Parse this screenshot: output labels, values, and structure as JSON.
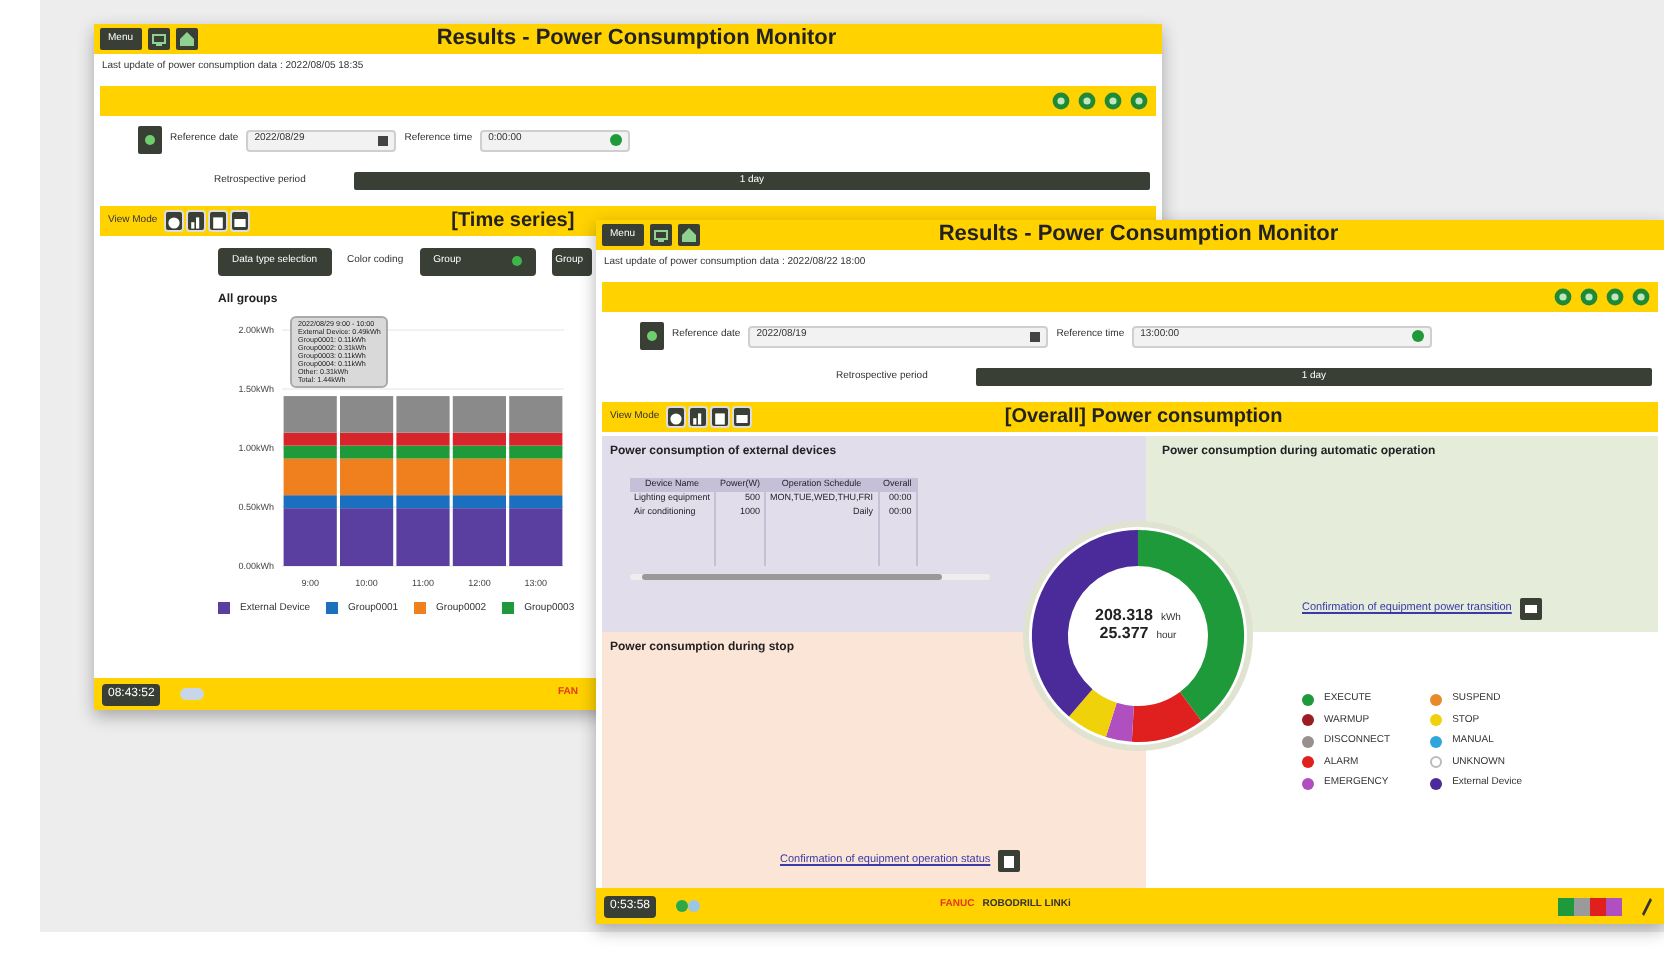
{
  "back_window": {
    "title": "Results - Power Consumption Monitor",
    "menu_button": "Menu",
    "last_update": "Last update of power consumption data : 2022/08/05 18:35",
    "reference_date_label": "Reference date",
    "reference_date": "2022/08/29",
    "reference_time_label": "Reference time",
    "reference_time": "0:00:00",
    "retrospective_label": "Retrospective period",
    "retrospective_value": "1 day",
    "view_mode_label": "View Mode",
    "view_title": "[Time series]",
    "data_type_button": "Data type selection",
    "color_coding_label": "Color coding",
    "color_coding_value": "Group",
    "group_select_button": "Group",
    "chart_title": "All groups",
    "tooltip": [
      "2022/08/29 9:00 - 10:00",
      "External Device: 0.49kWh",
      "Group0001: 0.11kWh",
      "Group0002: 0.31kWh",
      "Group0003: 0.11kWh",
      "Group0004: 0.11kWh",
      "Other: 0.31kWh",
      "Total: 1.44kWh"
    ],
    "chart_data": {
      "type": "bar",
      "stacked": true,
      "grid": true,
      "categories": [
        "9:00",
        "10:00",
        "11:00",
        "12:00",
        "13:00"
      ],
      "ylim": [
        0,
        2
      ],
      "yticks": [
        {
          "value": 0,
          "label": "0.00kWh"
        },
        {
          "value": 0.5,
          "label": "0.50kWh"
        },
        {
          "value": 1,
          "label": "1.00kWh"
        },
        {
          "value": 1.5,
          "label": "1.50kWh"
        },
        {
          "value": 2,
          "label": "2.00kWh"
        }
      ],
      "series": [
        {
          "name": "External Device",
          "color": "#5b3fa0",
          "values": [
            0.49,
            0.49,
            0.49,
            0.49,
            0.49
          ]
        },
        {
          "name": "Group0001",
          "color": "#1a6fbf",
          "values": [
            0.11,
            0.11,
            0.11,
            0.11,
            0.11
          ]
        },
        {
          "name": "Group0002",
          "color": "#f07f1e",
          "values": [
            0.31,
            0.31,
            0.31,
            0.31,
            0.31
          ]
        },
        {
          "name": "Group0003",
          "color": "#1f9a3a",
          "values": [
            0.11,
            0.11,
            0.11,
            0.11,
            0.11
          ]
        },
        {
          "color": "#d7262b",
          "values": [
            0.11,
            0.11,
            0.11,
            0.11,
            0.11
          ]
        },
        {
          "color": "#8a8a8a",
          "values": [
            0.31,
            0.31,
            0.31,
            0.31,
            0.31
          ]
        }
      ]
    },
    "clock": "08:43:52",
    "footer_brand": "FAN"
  },
  "front_window": {
    "title": "Results - Power Consumption Monitor",
    "menu_button": "Menu",
    "last_update": "Last update of power consumption data : 2022/08/22 18:00",
    "reference_date_label": "Reference date",
    "reference_date": "2022/08/19",
    "reference_time_label": "Reference time",
    "reference_time": "13:00:00",
    "retrospective_label": "Retrospective period",
    "retrospective_value": "1 day",
    "view_mode_label": "View Mode",
    "view_title": "[Overall] Power consumption",
    "external_panel": {
      "title": "Power consumption of external devices",
      "columns": [
        "Device Name",
        "Power(W)",
        "Operation Schedule",
        "Overall"
      ],
      "rows": [
        [
          "Lighting equipment",
          "500",
          "MON,TUE,WED,THU,FRI",
          "00:00"
        ],
        [
          "Air conditioning",
          "1000",
          "Daily",
          "00:00"
        ]
      ]
    },
    "auto_panel": {
      "title": "Power consumption during automatic operation",
      "link": "Confirmation of equipment power transition"
    },
    "stop_panel": {
      "title": "Power consumption during stop",
      "link": "Confirmation of equipment operation status"
    },
    "donut": {
      "energy": "208.318",
      "energy_unit": "kWh",
      "time": "25.377",
      "time_unit": "hour"
    },
    "legend": [
      {
        "label": "EXECUTE",
        "color": "#1f9a3a"
      },
      {
        "label": "WARMUP",
        "color": "#9b1c24"
      },
      {
        "label": "DISCONNECT",
        "color": "#9a8f8f"
      },
      {
        "label": "ALARM",
        "color": "#e0201f"
      },
      {
        "label": "EMERGENCY",
        "color": "#b04fc0"
      },
      {
        "label": "SUSPEND",
        "color": "#e88a2a"
      },
      {
        "label": "STOP",
        "color": "#f0d20a"
      },
      {
        "label": "MANUAL",
        "color": "#2fa6dd"
      },
      {
        "label": "UNKNOWN",
        "color": "#ffffff"
      },
      {
        "label": "External Device",
        "color": "#4b2a9a"
      }
    ],
    "clock": "0:53:58",
    "brand": "FANUC",
    "product": "ROBODRILL LINKi",
    "status_squares": [
      {
        "color": "#1f9a3a"
      },
      {
        "color": "#9a9a9a"
      },
      {
        "color": "#e0201f"
      },
      {
        "color": "#b04fc0"
      }
    ]
  }
}
